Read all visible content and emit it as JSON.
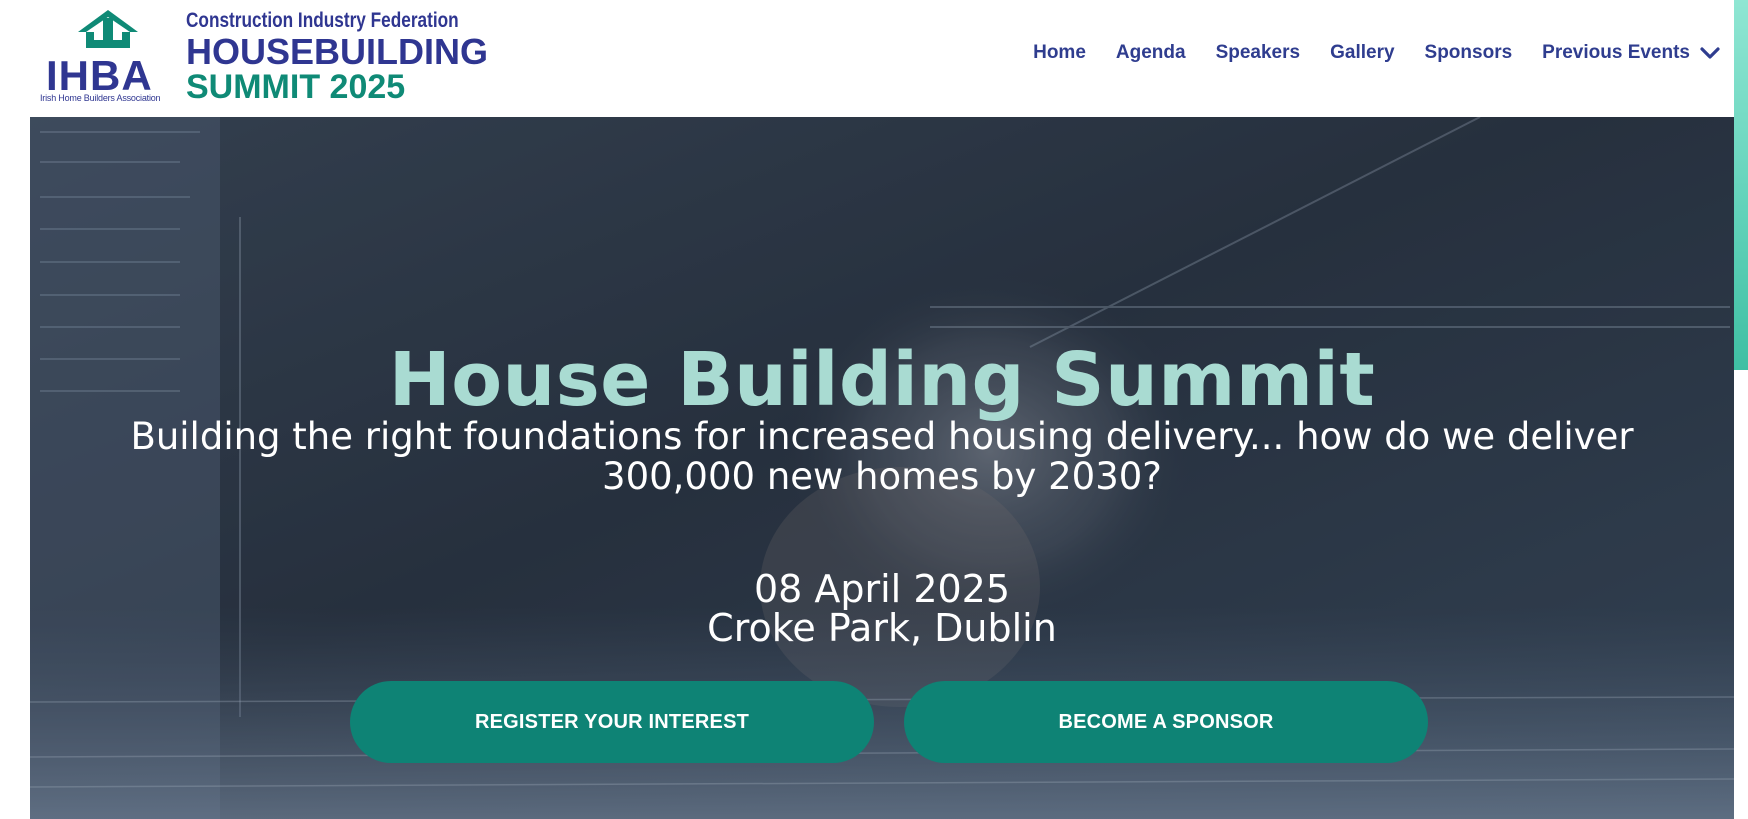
{
  "logo": {
    "ihba": "IHBA",
    "ihba_full": "Irish Home Builders Association",
    "cif": "Construction Industry Federation",
    "housebuilding": "HOUSEBUILDING",
    "summit": "SUMMIT 2025"
  },
  "nav": {
    "items": [
      {
        "label": "Home"
      },
      {
        "label": "Agenda"
      },
      {
        "label": "Speakers"
      },
      {
        "label": "Gallery"
      },
      {
        "label": "Sponsors"
      },
      {
        "label": "Previous Events"
      }
    ]
  },
  "hero": {
    "title": "House Building Summit",
    "subtitle": "Building the right foundations for increased housing delivery... how do we deliver 300,000 new homes by 2030?",
    "date": "08 April 2025",
    "venue": "Croke Park, Dublin",
    "register_label": "REGISTER YOUR INTEREST",
    "sponsor_label": "BECOME A SPONSOR"
  },
  "colors": {
    "brand_navy": "#2f3691",
    "brand_teal": "#0f8a76",
    "button_teal": "#0e8375",
    "title_mint": "#a9dbd2"
  },
  "icons": {
    "logo_mark": "house-roof-icon",
    "dropdown": "chevron-down-icon"
  }
}
